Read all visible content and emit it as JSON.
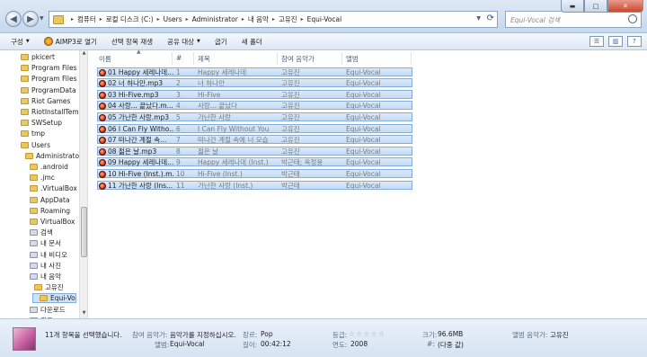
{
  "address": {
    "crumbs": [
      "컴퓨터",
      "로컬 디스크 (C:)",
      "Users",
      "Administrator",
      "내 음악",
      "고유진",
      "Equi-Vocal"
    ]
  },
  "search": {
    "placeholder": "Equi-Vocal 검색"
  },
  "toolbar": {
    "organize": "구성",
    "aimp_open": "AIMP3로 열기",
    "play_selection": "선택 항목 재생",
    "share": "공유 대상",
    "burn": "굽기",
    "new_folder": "새 폴더"
  },
  "nav": {
    "items": [
      {
        "label": "pkicert",
        "indent": 1,
        "selected": false,
        "media": false
      },
      {
        "label": "Program Files",
        "indent": 1,
        "selected": false,
        "media": false
      },
      {
        "label": "Program Files (",
        "indent": 1,
        "selected": false,
        "media": false
      },
      {
        "label": "ProgramData",
        "indent": 1,
        "selected": false,
        "media": false
      },
      {
        "label": "Riot Games",
        "indent": 1,
        "selected": false,
        "media": false
      },
      {
        "label": "RiotInstallTemp",
        "indent": 1,
        "selected": false,
        "media": false
      },
      {
        "label": "SWSetup",
        "indent": 1,
        "selected": false,
        "media": false
      },
      {
        "label": "tmp",
        "indent": 1,
        "selected": false,
        "media": false
      },
      {
        "label": "Users",
        "indent": 1,
        "selected": false,
        "media": false
      },
      {
        "label": "Administrato",
        "indent": 2,
        "selected": false,
        "media": false
      },
      {
        "label": ".android",
        "indent": 3,
        "selected": false,
        "media": false
      },
      {
        "label": ".jmc",
        "indent": 3,
        "selected": false,
        "media": false
      },
      {
        "label": ".VirtualBox",
        "indent": 3,
        "selected": false,
        "media": false
      },
      {
        "label": "AppData",
        "indent": 3,
        "selected": false,
        "media": false
      },
      {
        "label": "Roaming",
        "indent": 3,
        "selected": false,
        "media": false
      },
      {
        "label": "VirtualBox",
        "indent": 3,
        "selected": false,
        "media": false
      },
      {
        "label": "검색",
        "indent": 3,
        "selected": false,
        "media": true
      },
      {
        "label": "내 문서",
        "indent": 3,
        "selected": false,
        "media": true
      },
      {
        "label": "내 비디오",
        "indent": 3,
        "selected": false,
        "media": true
      },
      {
        "label": "내 사진",
        "indent": 3,
        "selected": false,
        "media": true
      },
      {
        "label": "내 음악",
        "indent": 3,
        "selected": false,
        "media": true
      },
      {
        "label": "고유진",
        "indent": 4,
        "selected": false,
        "media": false
      },
      {
        "label": "Equi-Vo",
        "indent": 5,
        "selected": true,
        "media": false
      },
      {
        "label": "다운로드",
        "indent": 3,
        "selected": false,
        "media": true
      },
      {
        "label": "링크",
        "indent": 3,
        "selected": false,
        "media": true
      }
    ]
  },
  "columns": {
    "name": "이름",
    "num": "#",
    "title": "제목",
    "artist": "참여 음악가",
    "album": "앨범"
  },
  "files": [
    {
      "name": "01 Happy 세레나데...",
      "num": "1",
      "title": "Happy 세레나데",
      "artist": "고유진",
      "album": "Equi-Vocal"
    },
    {
      "name": "02 너 하나만.mp3",
      "num": "2",
      "title": "너 하나만",
      "artist": "고유진",
      "album": "Equi-Vocal"
    },
    {
      "name": "03 Hi-Five.mp3",
      "num": "3",
      "title": "Hi-Five",
      "artist": "고유진",
      "album": "Equi-Vocal"
    },
    {
      "name": "04 사랑... 끝났다.m...",
      "num": "4",
      "title": "사랑... 끝났다",
      "artist": "고유진",
      "album": "Equi-Vocal"
    },
    {
      "name": "05 가난한 사랑.mp3",
      "num": "5",
      "title": "가난한 사랑",
      "artist": "고유진",
      "album": "Equi-Vocal"
    },
    {
      "name": "06 I Can Fly Witho...",
      "num": "6",
      "title": "I Can Fly Without You",
      "artist": "고유진",
      "album": "Equi-Vocal"
    },
    {
      "name": "07 떠나간 계절 속...",
      "num": "7",
      "title": "떠나간 계절 속에 너 모습",
      "artist": "고유진",
      "album": "Equi-Vocal"
    },
    {
      "name": "08 젊은 날.mp3",
      "num": "8",
      "title": "젊은 날",
      "artist": "고유진",
      "album": "Equi-Vocal"
    },
    {
      "name": "09 Happy 세레나데...",
      "num": "9",
      "title": "Happy 세레나데 (Inst.)",
      "artist": "박근태; 옥정용",
      "album": "Equi-Vocal"
    },
    {
      "name": "10 Hi-Five (Inst.).m...",
      "num": "10",
      "title": "Hi-Five (Inst.)",
      "artist": "박근태",
      "album": "Equi-Vocal"
    },
    {
      "name": "11 가난한 사랑 (Ins...",
      "num": "11",
      "title": "가난한 사랑 (Inst.)",
      "artist": "박근태",
      "album": "Equi-Vocal"
    }
  ],
  "details": {
    "summary": "11개 항목을 선택했습니다.",
    "artist_label": "참여 음악가:",
    "artist_value": "음악가를 지정하십시오.",
    "genre_label": "장르:",
    "genre_value": "Pop",
    "rating_label": "등급:",
    "rating_stars": "☆☆☆☆☆",
    "size_label": "크기:",
    "size_value": "96.6MB",
    "album_artist_label": "앨범 음악가:",
    "album_artist_value": "고유진",
    "album_label": "앨범:",
    "album_value": "Equi-Vocal",
    "length_label": "길이:",
    "length_value": "00:42:12",
    "year_label": "연도:",
    "year_value": "2008",
    "track_label": "#:",
    "track_value": "(다중 값)"
  }
}
